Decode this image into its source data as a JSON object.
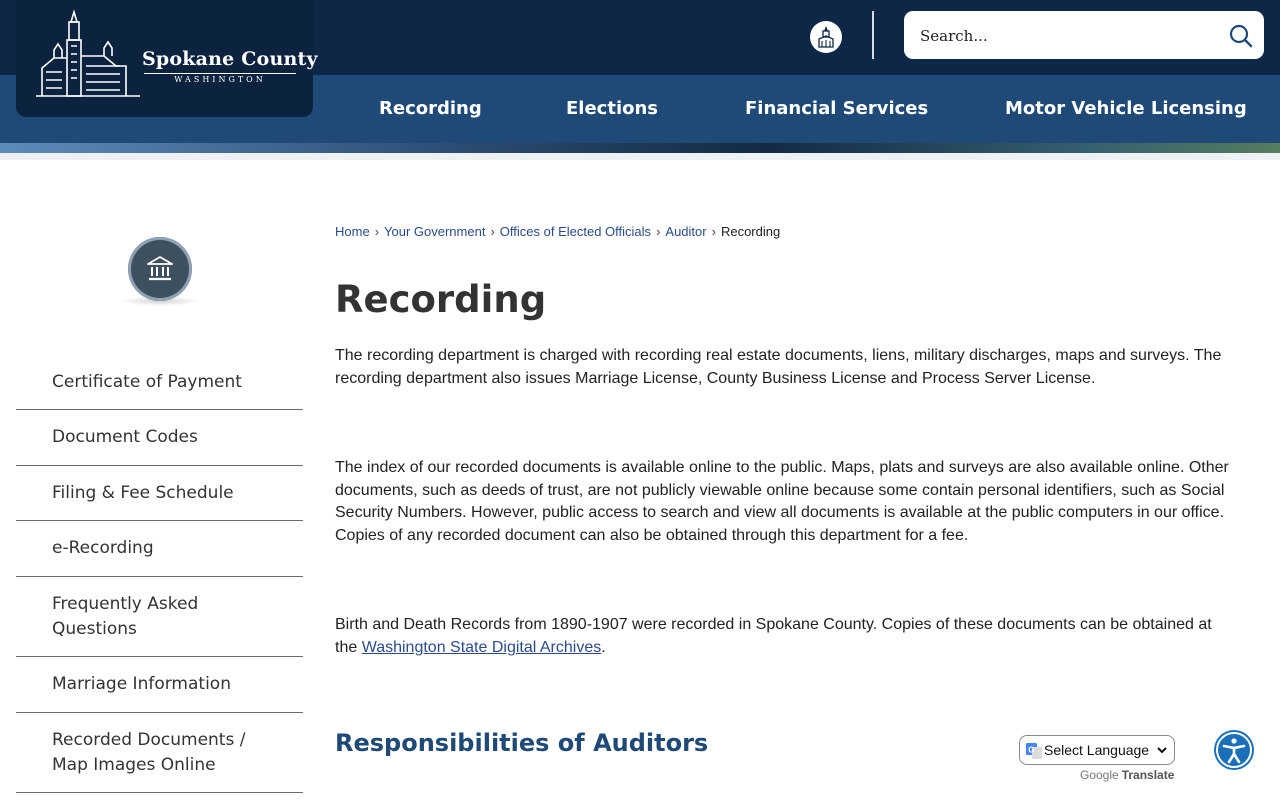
{
  "header": {
    "logo": {
      "name": "Spokane County",
      "subtitle": "WASHINGTON"
    },
    "search": {
      "placeholder": "Search..."
    },
    "nav": [
      {
        "label": "Recording"
      },
      {
        "label": "Elections"
      },
      {
        "label": "Financial Services"
      },
      {
        "label": "Motor Vehicle Licensing"
      }
    ]
  },
  "sidebar": {
    "icon": "government-building-icon",
    "items": [
      {
        "label": "Certificate of Payment"
      },
      {
        "label": "Document Codes"
      },
      {
        "label": "Filing & Fee Schedule"
      },
      {
        "label": "e-Recording"
      },
      {
        "label": "Frequently Asked Questions"
      },
      {
        "label": "Marriage Information"
      },
      {
        "label": "Recorded Documents / Map Images Online"
      }
    ]
  },
  "breadcrumb": [
    {
      "label": "Home"
    },
    {
      "label": "Your Government"
    },
    {
      "label": "Offices of Elected Officials"
    },
    {
      "label": "Auditor"
    },
    {
      "label": "Recording"
    }
  ],
  "main": {
    "title": "Recording",
    "paragraphs": [
      "The recording department is charged with recording real estate documents, liens, military discharges, maps and surveys. The recording department also issues Marriage License, County Business License and Process Server License.",
      "The index of our recorded documents is available online to the public. Maps, plats and surveys are also available online. Other documents, such as deeds of trust, are not publicly viewable online because some contain personal identifiers, such as Social Security Numbers. However, public access to search and view all documents is available at the public computers in our office. Copies of any recorded document can also be obtained through this department for a fee."
    ],
    "paragraph3": {
      "text_before": "Birth and Death Records from 1890-1907 were recorded in Spokane County. Copies of these documents can be obtained at the ",
      "link": "Washington State Digital Archives",
      "text_after": "."
    },
    "section_heading": "Responsibilities of Auditors"
  },
  "translate": {
    "select_label": "Select Language",
    "powered_brand": "Google",
    "powered_text": "Translate"
  },
  "colors": {
    "header_dark": "#0e2746",
    "nav_blue": "#1f4a78",
    "link_blue": "#2a4c8c",
    "accessibility_blue": "#1b6fb8"
  }
}
